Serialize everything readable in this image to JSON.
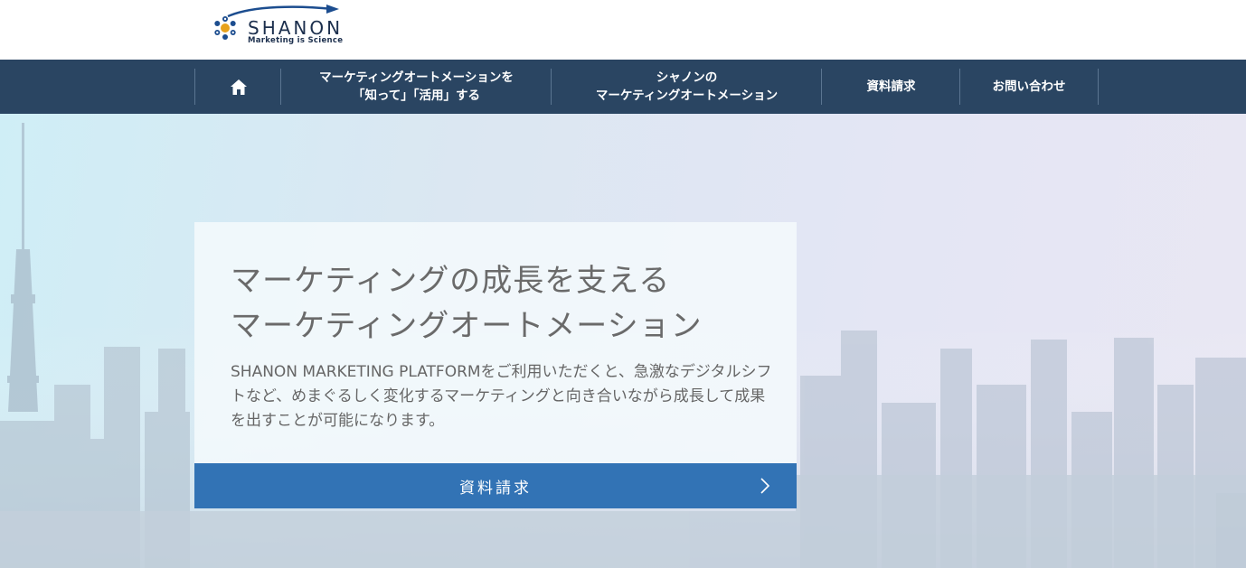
{
  "logo": {
    "name": "SHANON",
    "tagline": "Marketing is Science"
  },
  "nav": {
    "home_icon": "home-icon",
    "items": [
      {
        "label": "マーケティングオートメーションを\n「知って」「活用」する"
      },
      {
        "label": "シャノンの\nマーケティングオートメーション"
      },
      {
        "label": "資料請求"
      },
      {
        "label": "お問い合わせ"
      }
    ]
  },
  "hero": {
    "title": "マーケティングの成長を支える\nマーケティングオートメーション",
    "body": "SHANON MARKETING PLATFORMをご利用いただくと、急激なデジタルシフトなど、めまぐるしく変化するマーケティングと向き合いながら成長して成果を出すことが可能になります。",
    "cta_label": "資料請求"
  },
  "colors": {
    "nav_bg": "#2a4562",
    "cta_bg": "#3273b5",
    "logo": "#1c2f4d"
  }
}
